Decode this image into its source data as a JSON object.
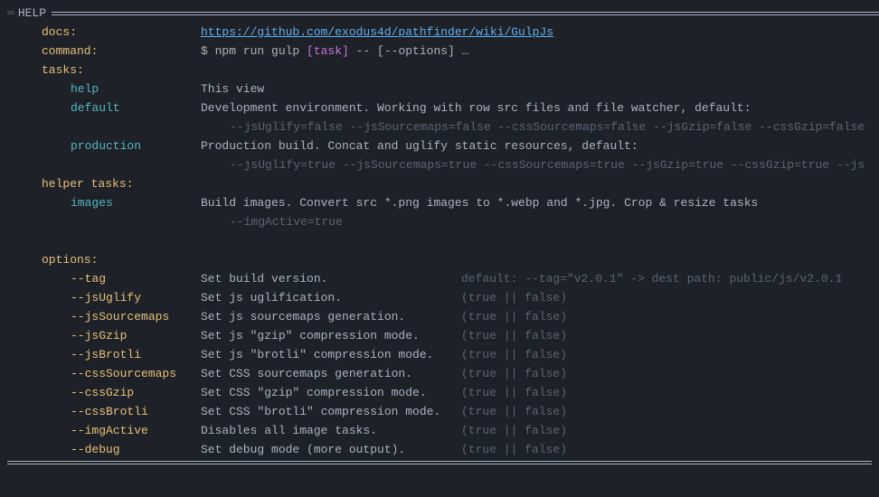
{
  "title": "HELP",
  "sections": {
    "docs": {
      "label": "docs:",
      "url": "https://github.com/exodus4d/pathfinder/wiki/GulpJs"
    },
    "command": {
      "label": "command:",
      "prefix": "$ npm run gulp ",
      "task": "[task]",
      "suffix": " -- [--options] …"
    },
    "tasks": {
      "label": "tasks:",
      "items": [
        {
          "name": "help",
          "desc": "This view"
        },
        {
          "name": "default",
          "desc": "Development environment. Working with row src files and file watcher, default:",
          "flags": "--jsUglify=false --jsSourcemaps=false --cssSourcemaps=false --jsGzip=false --cssGzip=false"
        },
        {
          "name": "production",
          "desc": "Production build. Concat and uglify static resources, default:",
          "flags": "--jsUglify=true --jsSourcemaps=true --cssSourcemaps=true --jsGzip=true --cssGzip=true --js"
        }
      ]
    },
    "helperTasks": {
      "label": "helper tasks:",
      "items": [
        {
          "name": "images",
          "desc": "Build images. Convert src *.png images to *.webp and *.jpg. Crop & resize tasks",
          "flags": "--imgActive=true"
        }
      ]
    },
    "options": {
      "label": "options:",
      "items": [
        {
          "name": "--tag",
          "desc": "Set build version.",
          "hint": "default: --tag=\"v2.0.1\" -> dest path: public/js/v2.0.1"
        },
        {
          "name": "--jsUglify",
          "desc": "Set js uglification.",
          "hint": "(true || false)"
        },
        {
          "name": "--jsSourcemaps",
          "desc": "Set js sourcemaps generation.",
          "hint": "(true || false)"
        },
        {
          "name": "--jsGzip",
          "desc": "Set js \"gzip\" compression mode.",
          "hint": "(true || false)"
        },
        {
          "name": "--jsBrotli",
          "desc": "Set js \"brotli\" compression mode.",
          "hint": "(true || false)"
        },
        {
          "name": "--cssSourcemaps",
          "desc": "Set CSS sourcemaps generation.",
          "hint": "(true || false)"
        },
        {
          "name": "--cssGzip",
          "desc": "Set CSS \"gzip\" compression mode.",
          "hint": "(true || false)"
        },
        {
          "name": "--cssBrotli",
          "desc": "Set CSS \"brotli\" compression mode.",
          "hint": "(true || false)"
        },
        {
          "name": "--imgActive",
          "desc": "Disables all image tasks.",
          "hint": "(true || false)"
        },
        {
          "name": "--debug",
          "desc": "Set debug mode (more output).",
          "hint": "(true || false)"
        }
      ]
    }
  }
}
